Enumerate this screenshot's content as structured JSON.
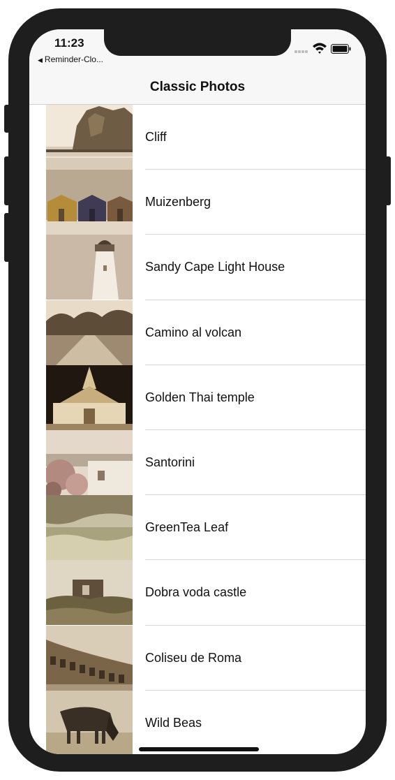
{
  "status_bar": {
    "time": "11:23",
    "back_app": "Reminder-Clo..."
  },
  "navbar": {
    "title": "Classic Photos"
  },
  "photos": [
    {
      "label": "Cliff"
    },
    {
      "label": "Muizenberg"
    },
    {
      "label": "Sandy Cape Light House"
    },
    {
      "label": "Camino al volcan"
    },
    {
      "label": "Golden Thai temple"
    },
    {
      "label": "Santorini"
    },
    {
      "label": "GreenTea Leaf"
    },
    {
      "label": "Dobra voda castle"
    },
    {
      "label": "Coliseu de Roma"
    },
    {
      "label": "Wild Beas"
    }
  ],
  "colors": {
    "frame": "#1e1e1e",
    "bar_background": "#f7f7f7",
    "separator": "#d6d6d6",
    "sepia_light": "#e9dcc6",
    "sepia_dark": "#3b2f22"
  }
}
